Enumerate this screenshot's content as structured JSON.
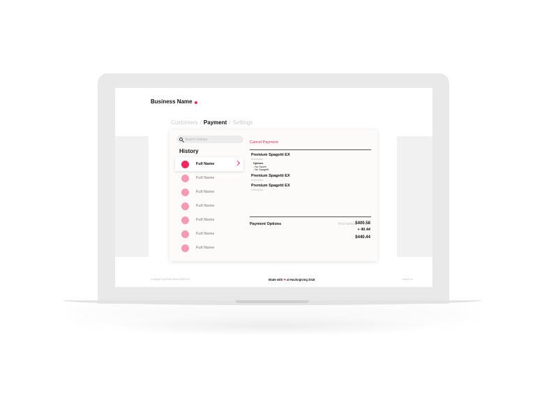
{
  "header": {
    "business_name": "Business Name"
  },
  "breadcrumb": {
    "customers": "Customers",
    "payment": "Payment",
    "settings": "Settings",
    "separator": "/"
  },
  "search": {
    "placeholder": "Search names"
  },
  "history": {
    "title": "History",
    "items": [
      {
        "name": "Full Name",
        "selected": true
      },
      {
        "name": "Full Name",
        "selected": false
      },
      {
        "name": "Full Name",
        "selected": false
      },
      {
        "name": "Full Name",
        "selected": false
      },
      {
        "name": "Full Name",
        "selected": false
      },
      {
        "name": "Full Name",
        "selected": false
      },
      {
        "name": "Full Name",
        "selected": false
      }
    ]
  },
  "payment": {
    "cancel_label": "Cancel Payment",
    "items": [
      {
        "title": "Premium Spagetti EX",
        "description": "Description",
        "options_header": "Options",
        "options": [
          "- No Sauce",
          "- No Spagetti"
        ]
      },
      {
        "title": "Premium Spagetti EX",
        "description": "Description"
      },
      {
        "title": "Premium Spagetti EX",
        "description": "Description"
      }
    ],
    "payment_options_label": "Payment Options",
    "total_label": "Total before",
    "amount_before": "$400.58",
    "amount_add": "+ 40.44",
    "amount_total": "$440.44"
  },
  "footer": {
    "copyright": "Copyright Big Plate Boss HBKG101",
    "made_with_prefix": "Made with",
    "made_with_suffix": "at Hackogiving 2018",
    "about": "About Us"
  },
  "colors": {
    "accent": "#f0275d",
    "accent_light": "#f59ab3",
    "screen_bg": "#ffffff",
    "laptop": "#e9e9ea"
  },
  "icons": {
    "search": "search-icon",
    "heart": "heart-icon",
    "chevron": "chevron-right-icon"
  }
}
